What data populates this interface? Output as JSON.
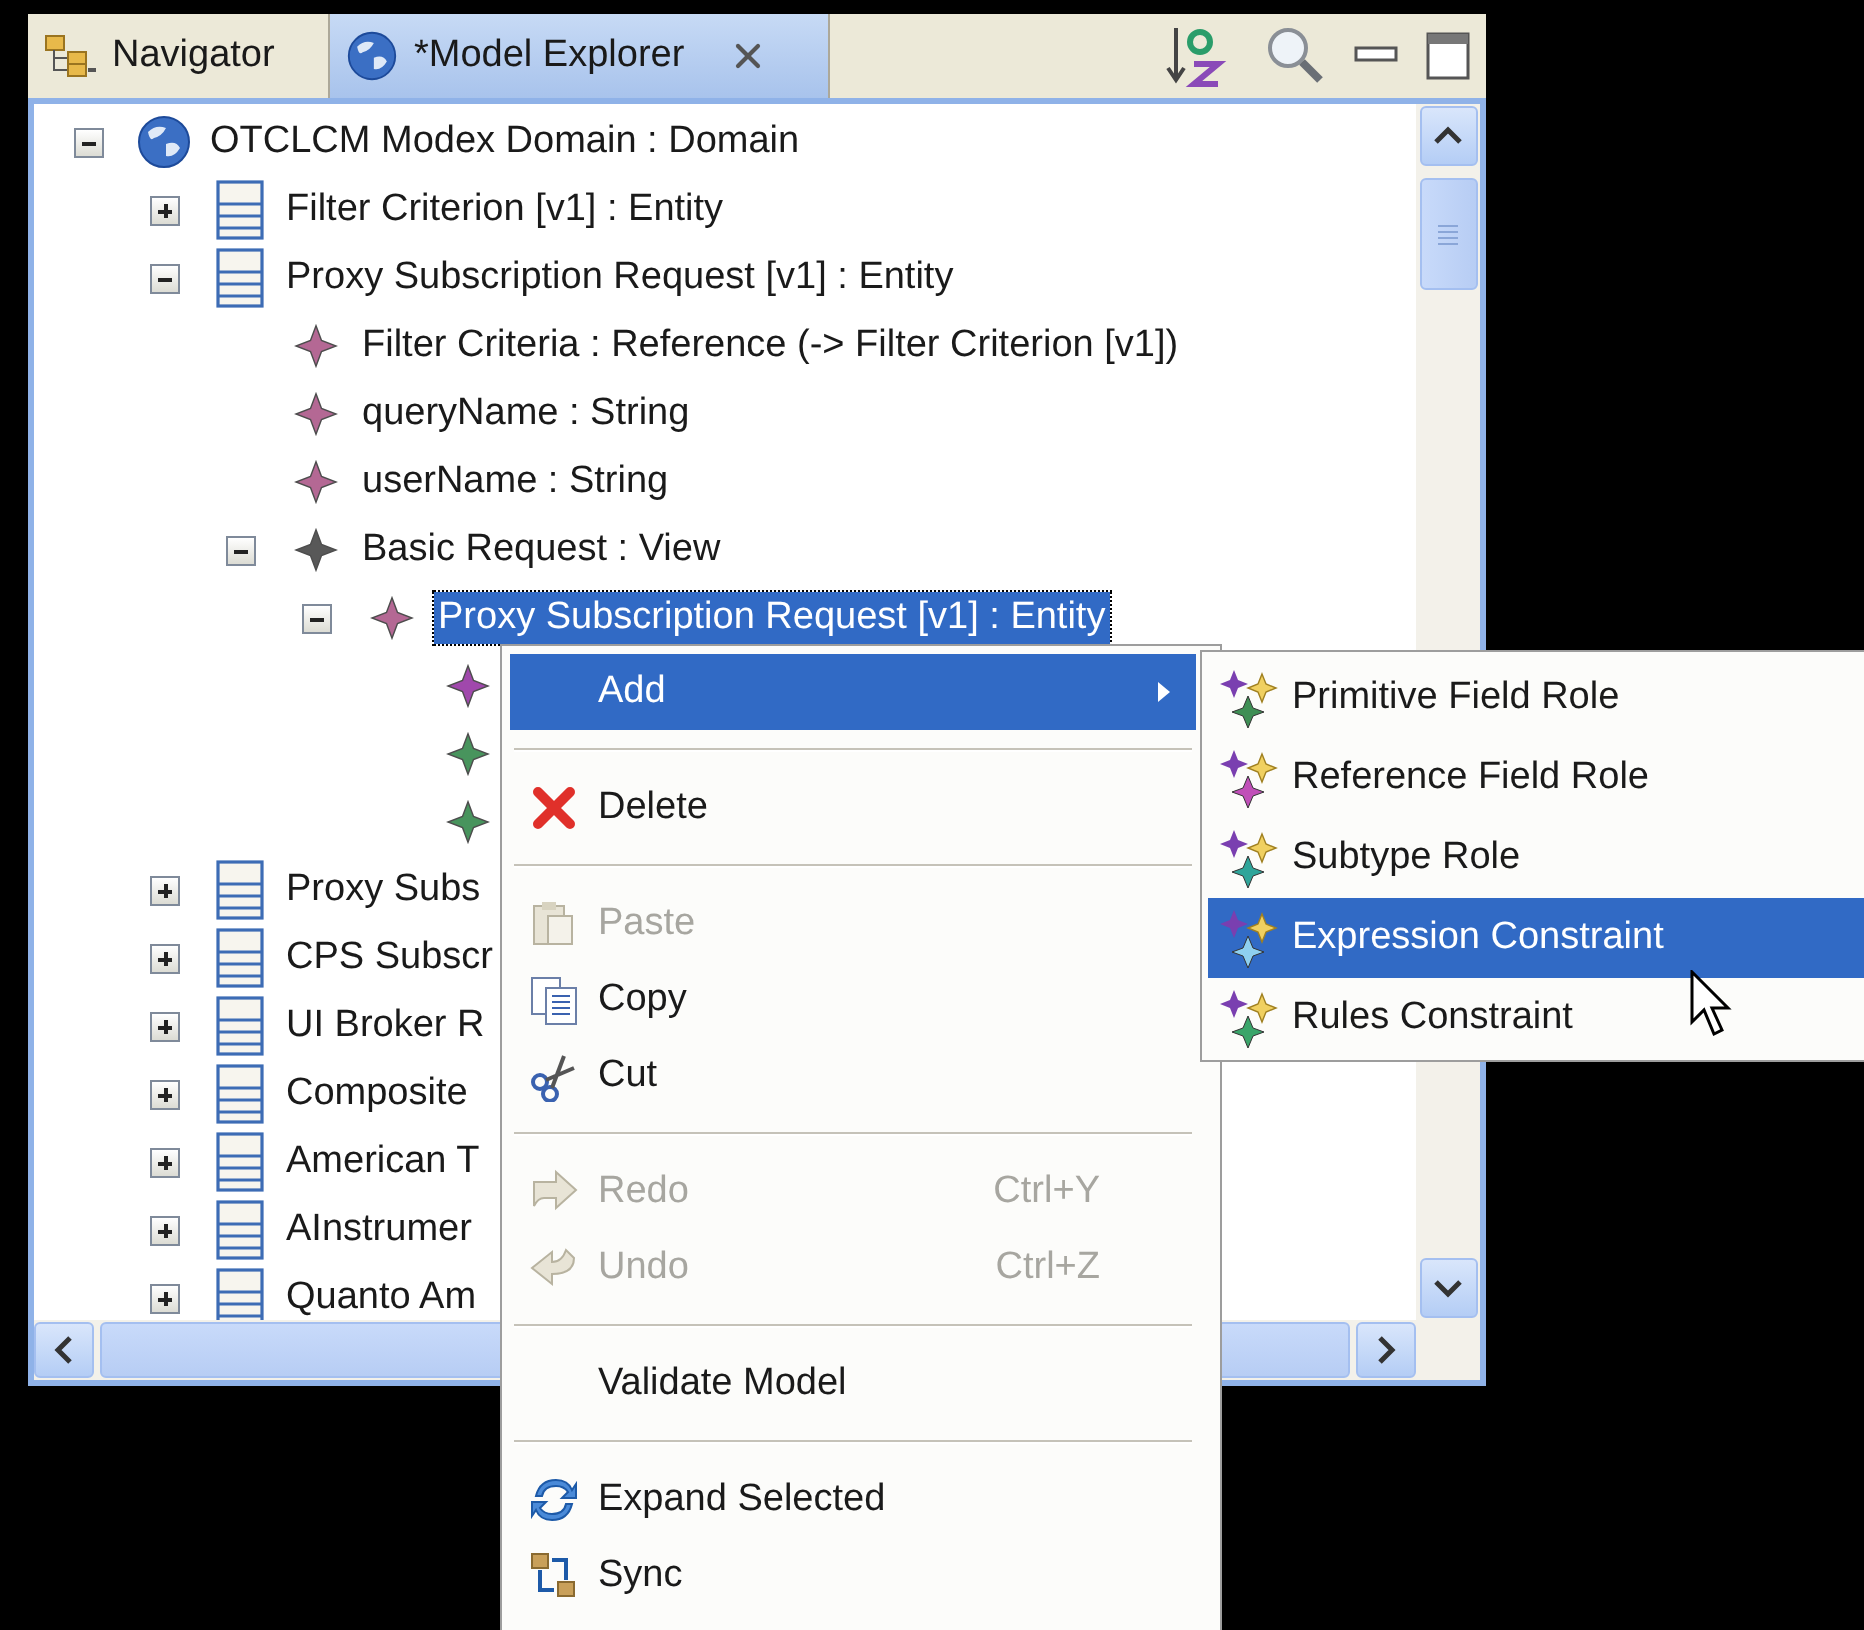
{
  "tabs": [
    {
      "label": "Navigator",
      "kind": "navigator",
      "selected": false,
      "closable": false
    },
    {
      "label": "*Model Explorer",
      "kind": "explorer",
      "selected": true,
      "closable": true
    }
  ],
  "tree": [
    {
      "label": "OTCLCM Modex Domain : Domain",
      "kind": "domain",
      "expanded": true,
      "selected": false,
      "children": [
        {
          "label": "Filter Criterion [v1] : Entity",
          "kind": "entity",
          "expanded": false,
          "selected": false
        },
        {
          "label": "Proxy Subscription Request [v1] : Entity",
          "kind": "entity",
          "expanded": true,
          "selected": false,
          "children": [
            {
              "label": "Filter Criteria : Reference (-> Filter Criterion [v1])",
              "kind": "diamond",
              "color": "#b0608f",
              "selected": false
            },
            {
              "label": "queryName : String",
              "kind": "diamond",
              "color": "#b0608f",
              "selected": false
            },
            {
              "label": "userName : String",
              "kind": "diamond",
              "color": "#b0608f",
              "selected": false
            },
            {
              "label": "Basic Request : View",
              "kind": "diamond",
              "color": "#505050",
              "expanded": true,
              "selected": false,
              "children": [
                {
                  "label": "Proxy Subscription Request [v1] : Entity",
                  "kind": "diamond",
                  "color": "#b0608f",
                  "expanded": true,
                  "selected": true,
                  "children": [
                    {
                      "kind": "diamond",
                      "color": "#9b3fa8"
                    },
                    {
                      "kind": "diamond",
                      "color": "#3f8f55"
                    },
                    {
                      "kind": "diamond",
                      "color": "#3f8f55"
                    }
                  ]
                }
              ]
            }
          ]
        },
        {
          "label": "Proxy Subs",
          "kind": "entity",
          "expanded": false,
          "selected": false
        },
        {
          "label": "CPS Subscr",
          "kind": "entity",
          "expanded": false,
          "selected": false
        },
        {
          "label": "UI Broker R",
          "kind": "entity",
          "expanded": false,
          "selected": false
        },
        {
          "label": "Composite",
          "kind": "entity",
          "expanded": false,
          "selected": false
        },
        {
          "label": "American T",
          "kind": "entity",
          "expanded": false,
          "selected": false
        },
        {
          "label": "AInstrumer",
          "kind": "entity",
          "expanded": false,
          "selected": false
        },
        {
          "label": "Quanto Am",
          "kind": "entity",
          "expanded": false,
          "selected": false
        }
      ]
    }
  ],
  "context_menu": [
    {
      "label": "Add",
      "kind": "submenu",
      "selected": true,
      "disabled": false
    },
    {
      "kind": "separator"
    },
    {
      "label": "Delete",
      "kind": "delete",
      "selected": false,
      "disabled": false
    },
    {
      "kind": "separator"
    },
    {
      "label": "Paste",
      "kind": "paste",
      "selected": false,
      "disabled": true
    },
    {
      "label": "Copy",
      "kind": "copy",
      "selected": false,
      "disabled": false
    },
    {
      "label": "Cut",
      "kind": "cut",
      "selected": false,
      "disabled": false
    },
    {
      "kind": "separator"
    },
    {
      "label": "Redo",
      "kind": "redo",
      "shortcut": "Ctrl+Y",
      "selected": false,
      "disabled": true
    },
    {
      "label": "Undo",
      "kind": "undo",
      "shortcut": "Ctrl+Z",
      "selected": false,
      "disabled": true
    },
    {
      "kind": "separator"
    },
    {
      "label": "Validate Model",
      "kind": "plain",
      "selected": false,
      "disabled": false
    },
    {
      "kind": "separator"
    },
    {
      "label": "Expand Selected",
      "kind": "expand",
      "selected": false,
      "disabled": false
    },
    {
      "label": "Sync",
      "kind": "sync",
      "selected": false,
      "disabled": false
    }
  ],
  "submenu": [
    {
      "label": "Primitive Field Role",
      "color": "#3f8f55",
      "selected": false
    },
    {
      "label": "Reference Field Role",
      "color": "#c04fb8",
      "selected": false
    },
    {
      "label": "Subtype Role",
      "color": "#2fa59a",
      "selected": false
    },
    {
      "label": "Expression Constraint",
      "color": "#8fd0f0",
      "selected": true
    },
    {
      "label": "Rules Constraint",
      "color": "#3aa56a",
      "selected": false
    }
  ]
}
